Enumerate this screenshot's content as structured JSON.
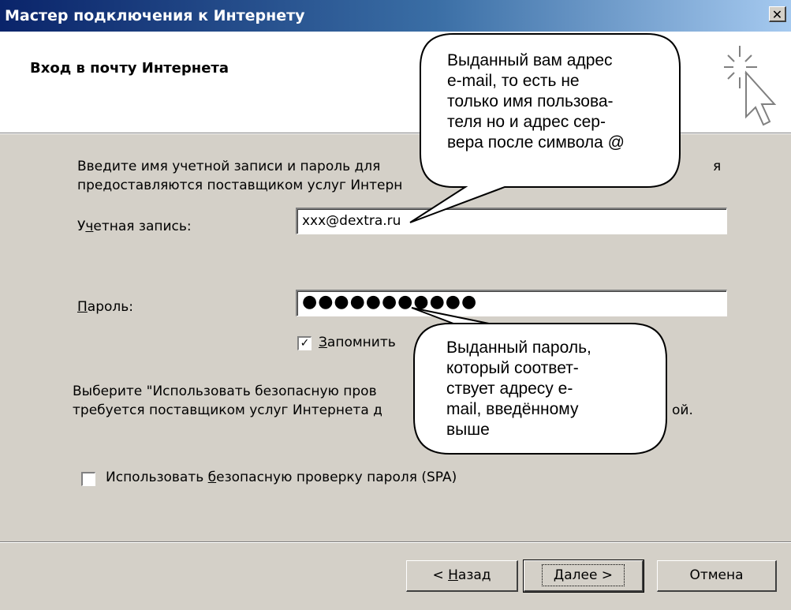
{
  "window": {
    "title": "Мастер подключения к Интернету",
    "close_glyph": "✕",
    "title_bar_colors": [
      "#0a246a",
      "#a6caf0"
    ]
  },
  "header": {
    "title": "Вход в почту Интернета",
    "icon": "wizard-cursor-sparkle-icon"
  },
  "intro": {
    "line1_visible": "Введите имя учетной записи и пароль для",
    "line1_tail": "я",
    "line2_visible": "предоставляются поставщиком услуг Интерн"
  },
  "account": {
    "label_pre": "У",
    "label_u": "ч",
    "label_post": "етная запись:",
    "value": "xxx@dextra.ru"
  },
  "password": {
    "label_u": "П",
    "label_post": "ароль:",
    "masked_value": "●●●●●●●●●●●"
  },
  "remember": {
    "checked": true,
    "check_glyph": "✓",
    "label_u": "З",
    "label_post": "апомнить"
  },
  "spa_text": {
    "line1_visible": "Выберите \"Использовать безопасную пров",
    "line2_visible": "требуется поставщиком услуг Интернета д",
    "line2_tail": "ой."
  },
  "spa_checkbox": {
    "checked": false,
    "label_pre": "Использовать ",
    "label_u": "б",
    "label_post": "езопасную проверку пароля (SPA)"
  },
  "buttons": {
    "back_pre": "< ",
    "back_u": "Н",
    "back_post": "азад",
    "next_u": "Д",
    "next_post": "алее >",
    "cancel": "Отмена"
  },
  "callouts": {
    "email_note": [
      "Выданный вам адрес",
      "e-mail, то есть не",
      "только имя пользова-",
      "теля но и адрес сер-",
      "вера после символа @"
    ],
    "password_note": [
      "Выданный пароль,",
      "который соответ-",
      "ствует адресу e-",
      "mail, введённому",
      "выше"
    ]
  }
}
